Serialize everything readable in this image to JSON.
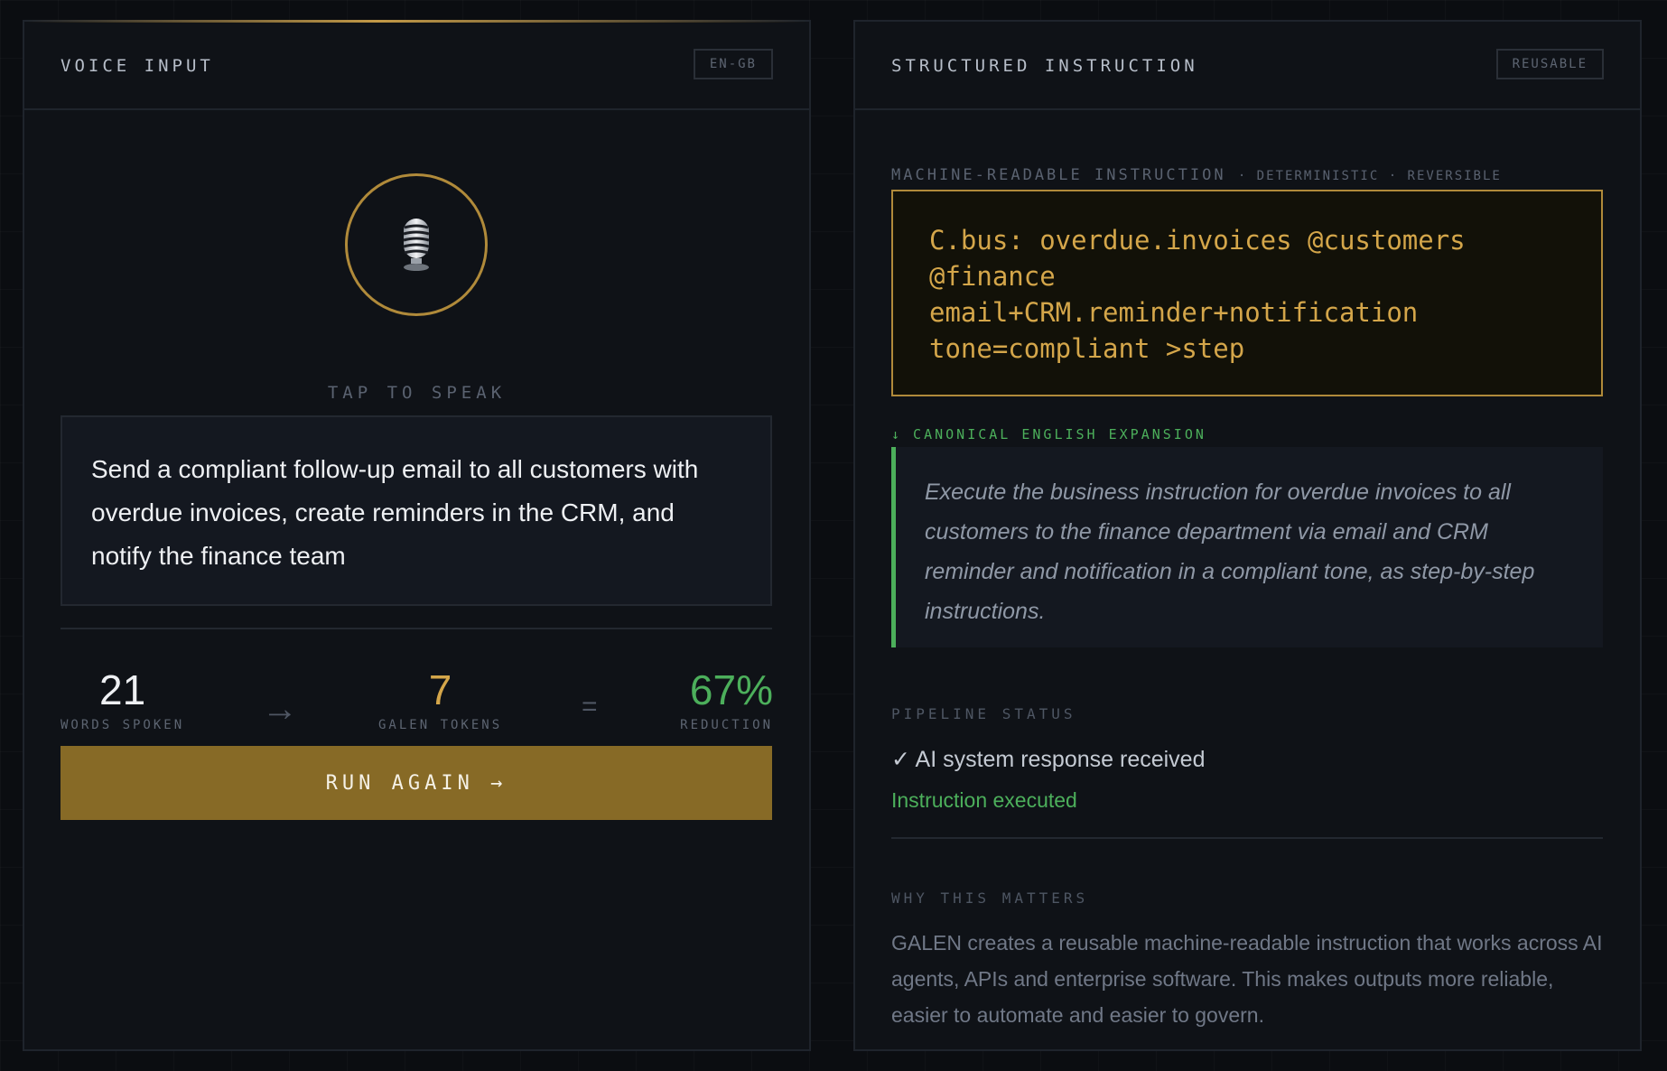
{
  "left": {
    "title": "VOICE INPUT",
    "locale_tag": "EN-GB",
    "mic_icon": "microphone-icon",
    "tap_label": "TAP TO SPEAK",
    "transcript": "Send a compliant follow-up email to all customers with overdue invoices, create reminders in the CRM, and notify the finance team",
    "stats": {
      "words_value": "21",
      "words_label": "WORDS SPOKEN",
      "arrow": "→",
      "tokens_value": "7",
      "tokens_label": "GALEN TOKENS",
      "equals": "=",
      "reduction_value": "67%",
      "reduction_label": "REDUCTION"
    },
    "run_button": "RUN AGAIN →"
  },
  "right": {
    "title": "STRUCTURED INSTRUCTION",
    "reuse_tag": "REUSABLE",
    "mri_label": "MACHINE-READABLE INSTRUCTION",
    "mri_qualifiers": "· DETERMINISTIC · REVERSIBLE",
    "code": "C.bus: overdue.invoices @customers\n@finance\nemail+CRM.reminder+notification\ntone=compliant >step",
    "expansion_label": "↓ CANONICAL ENGLISH EXPANSION",
    "expansion_text": "Execute the business instruction for overdue invoices to all customers to the finance department via email and CRM reminder and notification in a compliant tone, as step-by-step instructions.",
    "pipeline_label": "PIPELINE STATUS",
    "status_received": "✓ AI system response received",
    "status_executed": "Instruction executed",
    "why_label": "WHY THIS MATTERS",
    "why_text": "GALEN creates a reusable machine-readable instruction that works across AI agents, APIs and enterprise software. This makes outputs more reliable, easier to automate and easier to govern."
  },
  "colors": {
    "accent_gold": "#d4a64a",
    "button_gold": "#876a26",
    "success_green": "#4caf5b",
    "background": "#0b0d11"
  }
}
